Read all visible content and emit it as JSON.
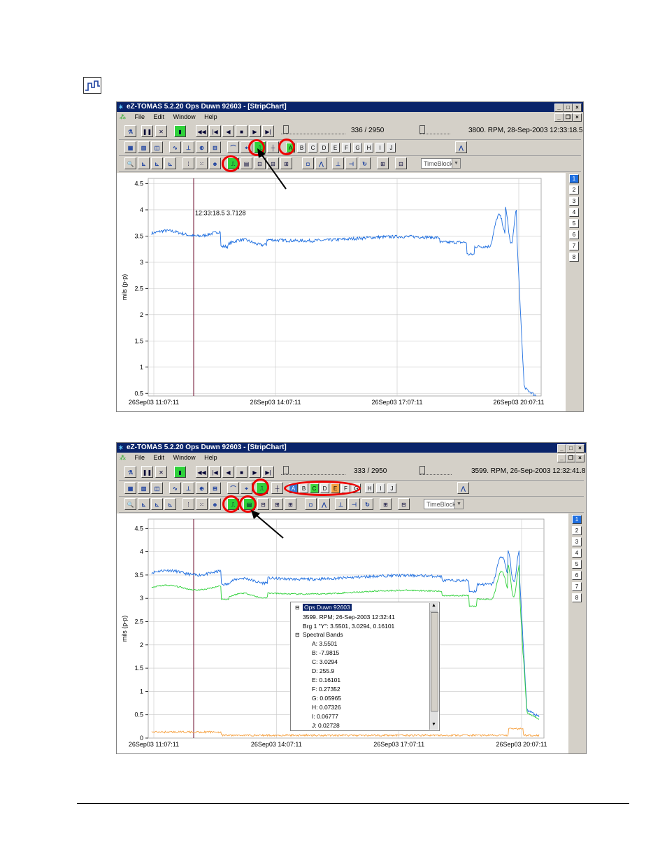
{
  "chart_icon": "strip-chart-icon",
  "colors": {
    "title_bar": "#0a246a",
    "series_blue": "#1f6fe0",
    "series_green": "#2fd13a",
    "series_orange": "#f6a243",
    "cursor": "#6b0b2b",
    "highlight_circle": "#e00000"
  },
  "top": {
    "title": "eZ-TOMAS 5.2.20    Ops Duwn 92603 - [StripChart]",
    "menu": [
      "File",
      "Edit",
      "Window",
      "Help"
    ],
    "position": "336 / 2950",
    "status": "3800. RPM,  28-Sep-2003 12:33:18.5",
    "band_labels": [
      "A",
      "B",
      "C",
      "D",
      "E",
      "F",
      "G",
      "H",
      "I",
      "J"
    ],
    "dropdown": "TimeBlock",
    "cursor_label": "12:33:18.5   3.7128",
    "ylabel": "mils (p-p)",
    "yticks": [
      "0.5",
      "1",
      "1.5",
      "2",
      "2.5",
      "3",
      "3.5",
      "4",
      "4.5"
    ],
    "xticks": [
      "26Sep03 11:07:11",
      "26Sep03 14:07:11",
      "26Sep03 17:07:11",
      "26Sep03 20:07:11"
    ],
    "pages": [
      "1",
      "2",
      "3",
      "4",
      "5",
      "6",
      "7",
      "8"
    ]
  },
  "bottom": {
    "title": "eZ-TOMAS 5.2.20    Ops Duwn 92603 - [StripChart]",
    "menu": [
      "File",
      "Edit",
      "Window",
      "Help"
    ],
    "position": "333 / 2950",
    "status": "3599. RPM,  26-Sep-2003 12:32:41.8",
    "band_labels": [
      "A",
      "B",
      "C",
      "D",
      "E",
      "F",
      "G",
      "H",
      "I",
      "J"
    ],
    "dropdown": "TimeBlock",
    "ylabel": "mils (p-p)",
    "yticks": [
      "0",
      "0.5",
      "1",
      "1.5",
      "2",
      "2.5",
      "3",
      "3.5",
      "4",
      "4.5"
    ],
    "xticks": [
      "26Sep03 11:07:11",
      "26Sep03 14:07:11",
      "26Sep03 17:07:11",
      "26Sep03 20:07:11"
    ],
    "pages": [
      "1",
      "2",
      "3",
      "4",
      "5",
      "6",
      "7",
      "8"
    ],
    "tree": {
      "root": "Ops Duwn 92603",
      "rpm_line": "3599. RPM;  26-Sep-2003 12:32:41",
      "brg_line": "Brg 1 \"Y\":  3.5501, 3.0294, 0.16101",
      "bands_header": "Spectral Bands",
      "bands": [
        "A:  3.5501",
        "B:  -7.9815",
        "C:  3.0294",
        "D:  255.9",
        "E:  0.16101",
        "F:  0.27352",
        "G:  0.05965",
        "H:  0.07326",
        "I:  0.06777",
        "J:  0.02728"
      ]
    }
  }
}
